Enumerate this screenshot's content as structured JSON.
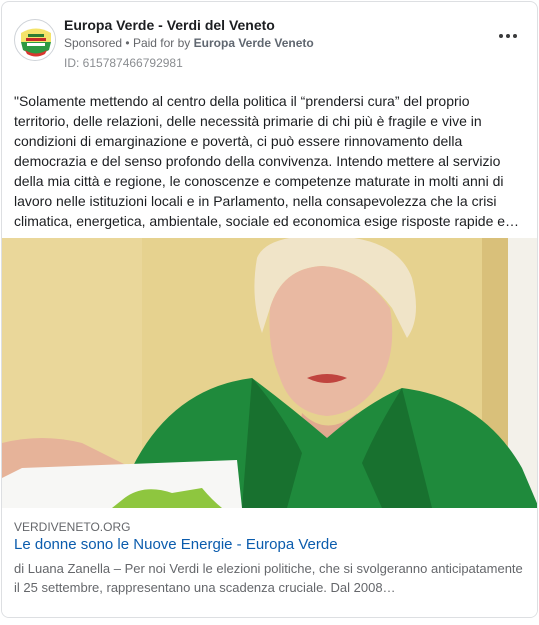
{
  "ad": {
    "page_name": "Europa Verde - Verdi del Veneto",
    "sponsored_label": "Sponsored",
    "paid_for_prefix": "Paid for by",
    "paid_for_by": "Europa Verde Veneto",
    "ad_id": "ID: 615787466792981",
    "more_icon": "more-options-icon",
    "body_text": "\"Solamente mettendo al centro della politica il “prendersi cura” del proprio territorio, delle relazioni, delle necessità primarie di chi più è fragile e vive in condizioni di emarginazione e povertà, ci può essere rinnovamento della democrazia e del senso profondo della convivenza. Intendo mettere al servizio della mia città e regione, le conoscenze e competenze maturate in molti anni di lavoro nelle istituzioni locali e in Parlamento, nella consapevolezza che la crisi climatica, energetica, ambientale, sociale ed economica esige risposte rapide e…"
  },
  "link_preview": {
    "domain": "VERDIVENETO.ORG",
    "title": "Le donne sono le Nuove Energie - Europa Verde",
    "description": "di Luana Zanella – Per noi Verdi le elezioni politiche, che si svolgeranno anticipatamente il 25 settembre, rappresentano una scadenza cruciale. Dal 2008…"
  },
  "colors": {
    "link_title": "#0b5cad",
    "secondary_text": "#65676b",
    "shirt_green": "#1f8a3c",
    "wall_yellow": "#e3cf8a"
  }
}
